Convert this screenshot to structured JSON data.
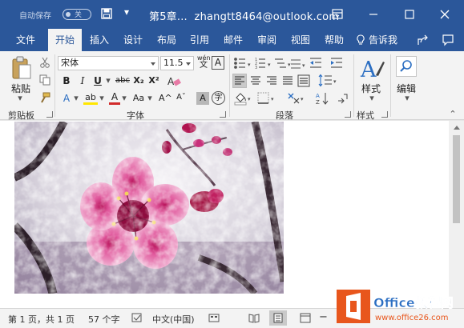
{
  "titlebar": {
    "autosave_label": "自动保存",
    "autosave_state": "关",
    "doc_title": "第5章...",
    "account": "zhangtt8464@outlook.com"
  },
  "tabs": [
    {
      "label": "文件"
    },
    {
      "label": "开始"
    },
    {
      "label": "插入"
    },
    {
      "label": "设计"
    },
    {
      "label": "布局"
    },
    {
      "label": "引用"
    },
    {
      "label": "邮件"
    },
    {
      "label": "审阅"
    },
    {
      "label": "视图"
    },
    {
      "label": "帮助"
    }
  ],
  "tell_me": "告诉我",
  "ribbon": {
    "clipboard": {
      "paste_label": "粘贴",
      "group_label": "剪贴板"
    },
    "font": {
      "font_name": "宋体",
      "font_size": "11.5",
      "wen_label": "wén",
      "A_box": "A",
      "bold": "B",
      "italic": "I",
      "underline": "U",
      "strike": "abc",
      "sub": "X₂",
      "sup": "X²",
      "effects": "A",
      "highlight": "ab",
      "color": "A",
      "aa": "Aa",
      "grow": "A^",
      "shrink": "Aˇ",
      "charshade": "A",
      "enclose": "字",
      "group_label": "字体"
    },
    "paragraph": {
      "group_label": "段落"
    },
    "styles": {
      "label": "样式",
      "group_label": "样式"
    },
    "editing": {
      "label": "编辑"
    }
  },
  "status": {
    "page": "第 1 页，共 1 页",
    "words": "57 个字",
    "language": "中文(中国)",
    "zoom_minus": "−"
  },
  "watermark": {
    "line1": "Office教程网",
    "line2": "www.office26.com"
  },
  "colors": {
    "accent": "#2b579a",
    "brand_orange": "#e8561c",
    "font_red": "#d12b2b",
    "highlight_yellow": "#ffe600"
  }
}
